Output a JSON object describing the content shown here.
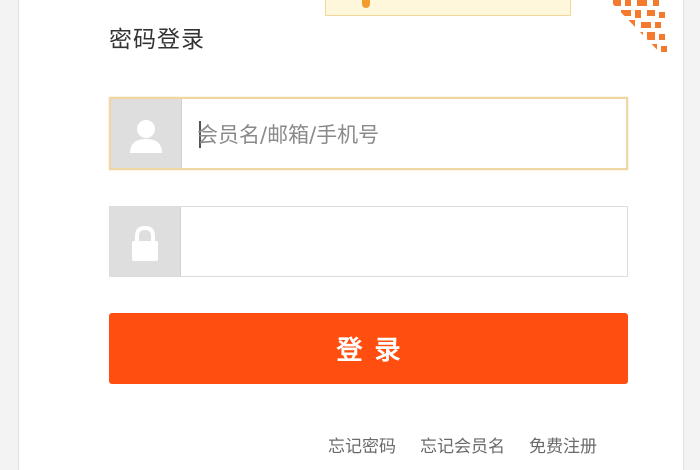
{
  "login": {
    "title": "密码登录",
    "username": {
      "placeholder": "会员名/邮箱/手机号",
      "value": "",
      "icon": "user-icon"
    },
    "password": {
      "placeholder": "",
      "value": "",
      "icon": "lock-icon"
    },
    "submit_label": "登录"
  },
  "links": {
    "forgot_password": "忘记密码",
    "forgot_username": "忘记会员名",
    "register": "免费注册"
  },
  "colors": {
    "accent": "#ff4e0f",
    "focus_border": "#efd6a2",
    "icon_bg": "#dedede",
    "qr_orange": "#f47a2e"
  }
}
